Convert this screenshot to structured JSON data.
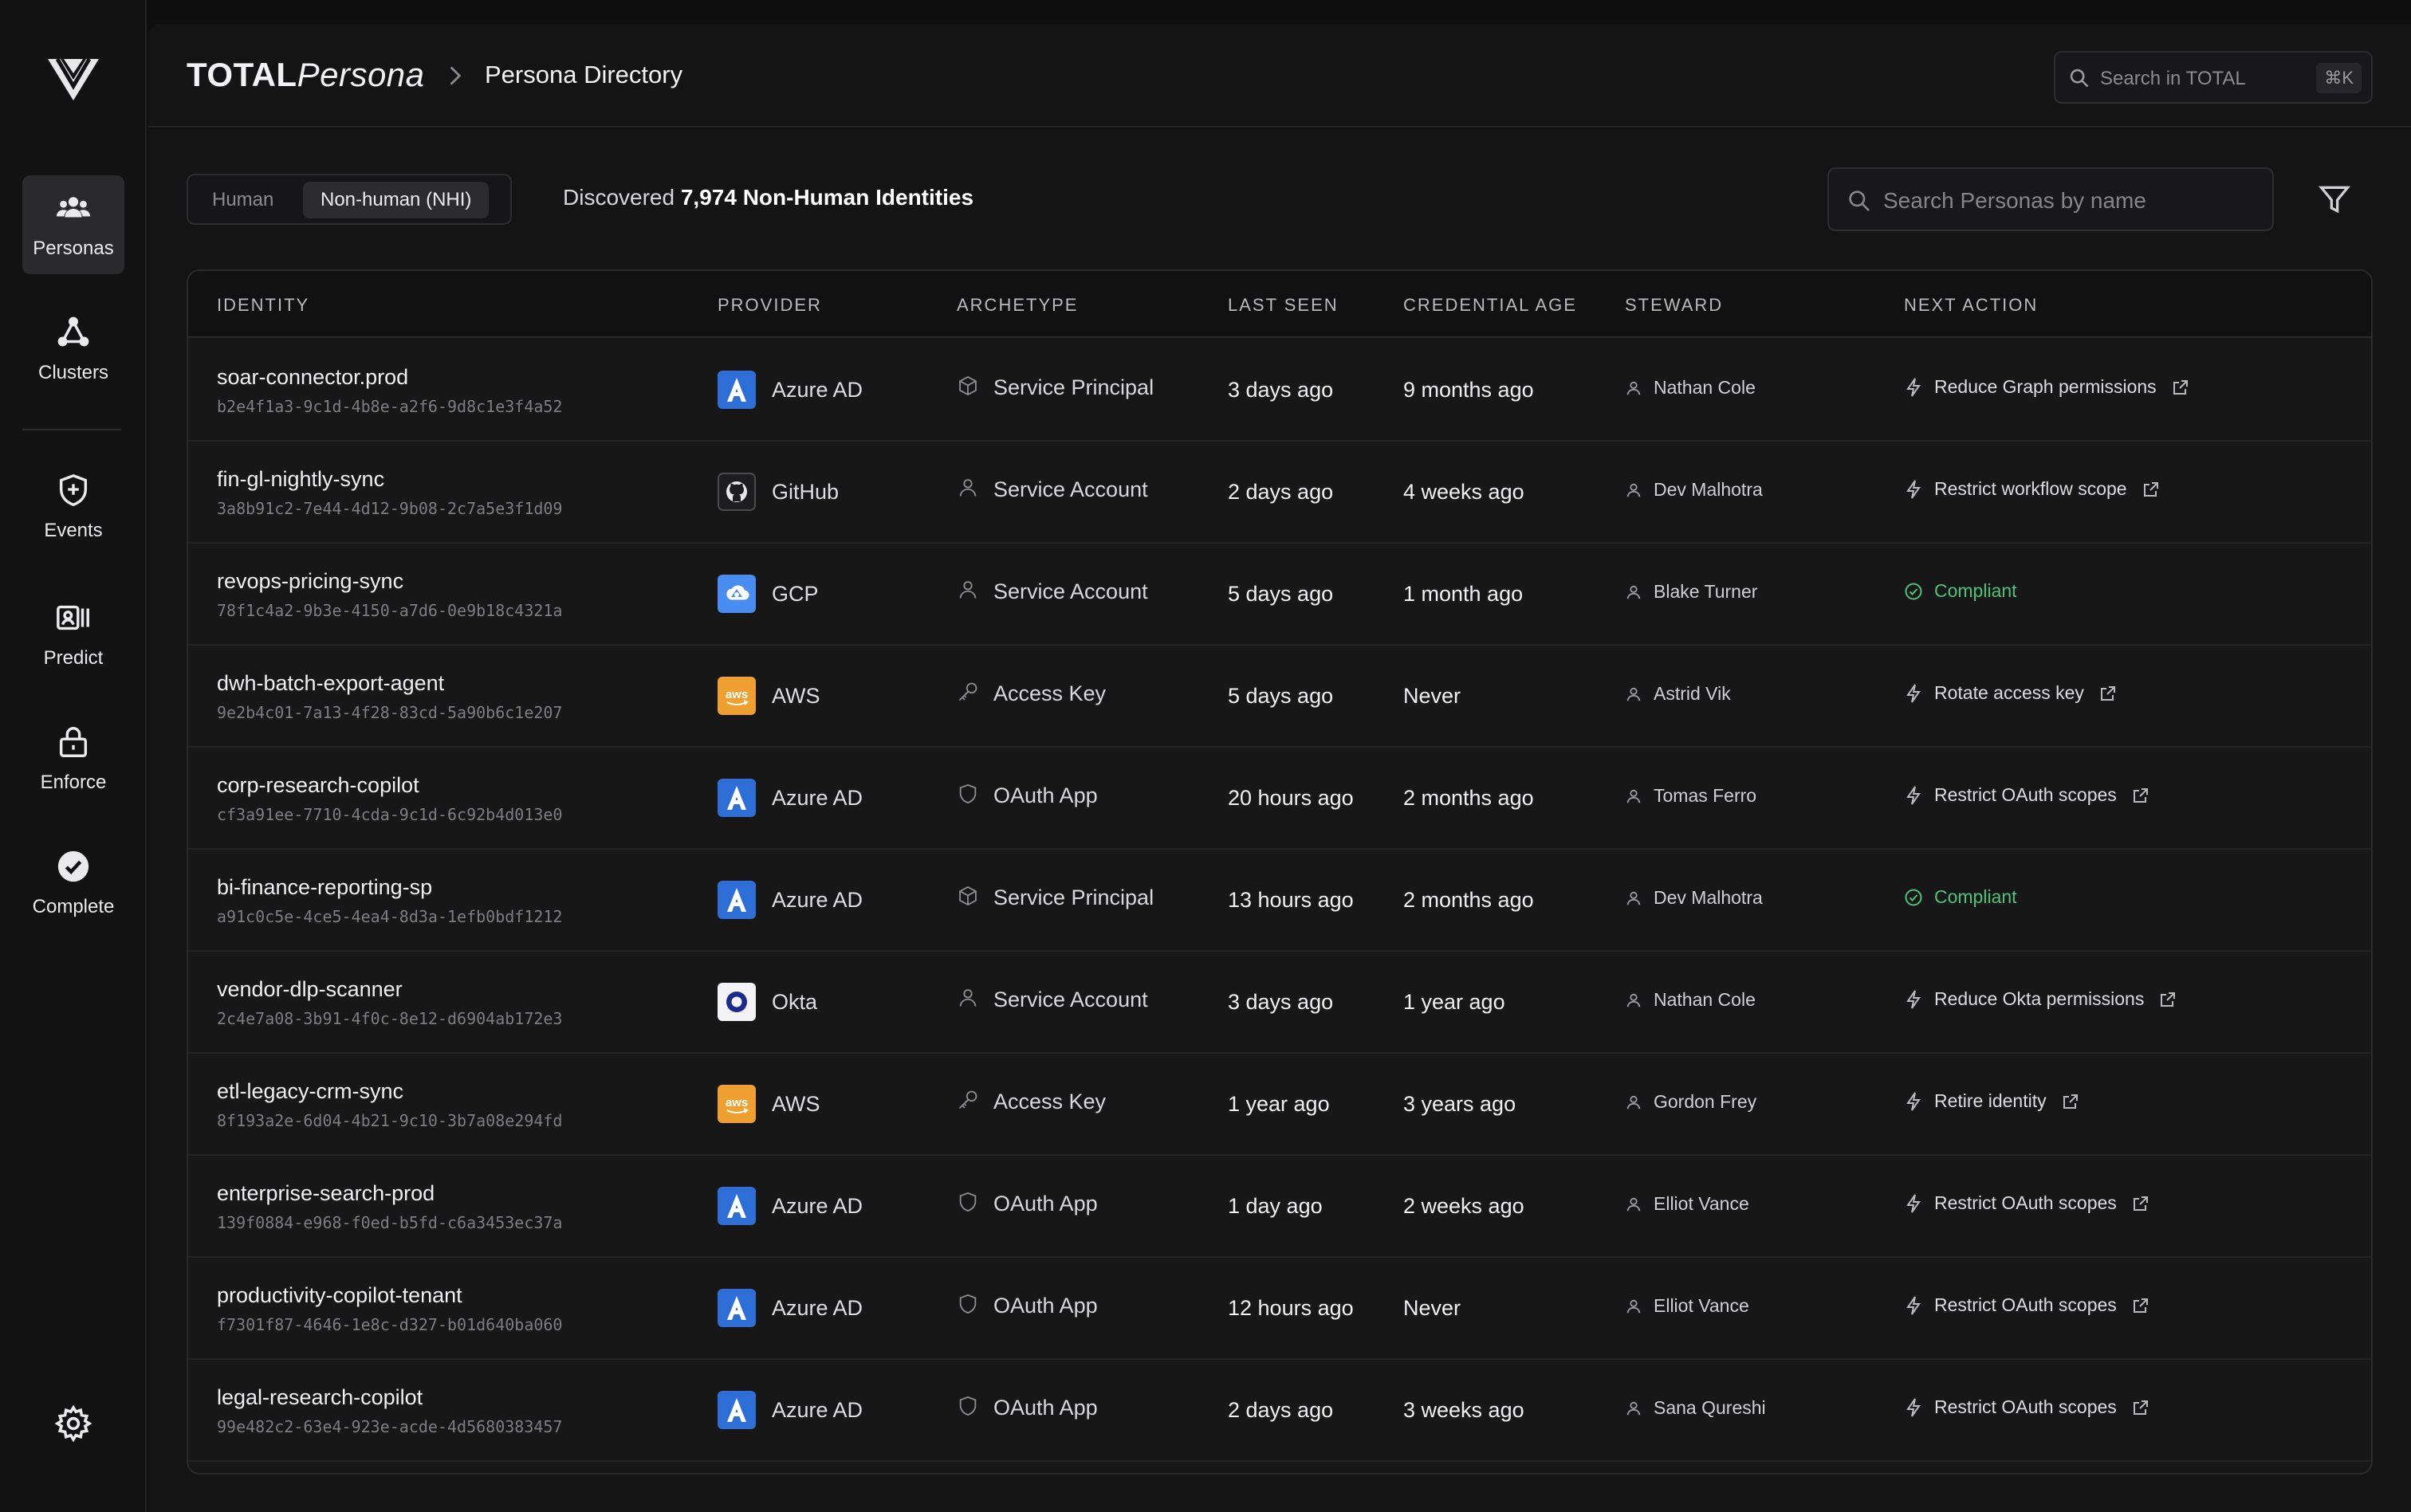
{
  "sidebar": {
    "items": [
      {
        "label": "Personas",
        "icon": "users-icon"
      },
      {
        "label": "Clusters",
        "icon": "cluster-icon"
      },
      {
        "label": "Events",
        "icon": "shield-plus-icon"
      },
      {
        "label": "Predict",
        "icon": "id-card-icon"
      },
      {
        "label": "Enforce",
        "icon": "lock-icon"
      },
      {
        "label": "Complete",
        "icon": "check-circle-icon"
      }
    ],
    "settings_icon": "gear-icon"
  },
  "header": {
    "brand_bold": "TOTAL",
    "brand_italic": "Persona",
    "page": "Persona Directory",
    "search_placeholder": "Search in TOTAL",
    "search_shortcut": "⌘K"
  },
  "toolbar": {
    "tabs": [
      "Human",
      "Non-human (NHI)"
    ],
    "active_tab": "Non-human (NHI)",
    "discovered_prefix": "Discovered",
    "discovered_count": "7,974 Non-Human Identities",
    "search_placeholder": "Search Personas by name"
  },
  "table": {
    "columns": [
      "IDENTITY",
      "PROVIDER",
      "ARCHETYPE",
      "LAST SEEN",
      "CREDENTIAL AGE",
      "STEWARD",
      "NEXT ACTION"
    ],
    "rows": [
      {
        "name": "soar-connector.prod",
        "id": "b2e4f1a3-9c1d-4b8e-a2f6-9d8c1e3f4a52",
        "provider": "Azure AD",
        "archetype": "Service Principal",
        "last_seen": "3 days ago",
        "credential_age": "9 months ago",
        "steward": "Nathan Cole",
        "action": "Reduce Graph permissions",
        "status": "action"
      },
      {
        "name": "fin-gl-nightly-sync",
        "id": "3a8b91c2-7e44-4d12-9b08-2c7a5e3f1d09",
        "provider": "GitHub",
        "archetype": "Service Account",
        "last_seen": "2 days ago",
        "credential_age": "4 weeks ago",
        "steward": "Dev Malhotra",
        "action": "Restrict workflow scope",
        "status": "action"
      },
      {
        "name": "revops-pricing-sync",
        "id": "78f1c4a2-9b3e-4150-a7d6-0e9b18c4321a",
        "provider": "GCP",
        "archetype": "Service Account",
        "last_seen": "5 days ago",
        "credential_age": "1 month ago",
        "steward": "Blake Turner",
        "action": "Compliant",
        "status": "compliant"
      },
      {
        "name": "dwh-batch-export-agent",
        "id": "9e2b4c01-7a13-4f28-83cd-5a90b6c1e207",
        "provider": "AWS",
        "archetype": "Access Key",
        "last_seen": "5 days ago",
        "credential_age": "Never",
        "steward": "Astrid Vik",
        "action": "Rotate access key",
        "status": "action"
      },
      {
        "name": "corp-research-copilot",
        "id": "cf3a91ee-7710-4cda-9c1d-6c92b4d013e0",
        "provider": "Azure AD",
        "archetype": "OAuth App",
        "last_seen": "20 hours ago",
        "credential_age": "2 months ago",
        "steward": "Tomas Ferro",
        "action": "Restrict OAuth scopes",
        "status": "action"
      },
      {
        "name": "bi-finance-reporting-sp",
        "id": "a91c0c5e-4ce5-4ea4-8d3a-1efb0bdf1212",
        "provider": "Azure AD",
        "archetype": "Service Principal",
        "last_seen": "13 hours ago",
        "credential_age": "2 months ago",
        "steward": "Dev Malhotra",
        "action": "Compliant",
        "status": "compliant"
      },
      {
        "name": "vendor-dlp-scanner",
        "id": "2c4e7a08-3b91-4f0c-8e12-d6904ab172e3",
        "provider": "Okta",
        "archetype": "Service Account",
        "last_seen": "3 days ago",
        "credential_age": "1 year ago",
        "steward": "Nathan Cole",
        "action": "Reduce Okta permissions",
        "status": "action"
      },
      {
        "name": "etl-legacy-crm-sync",
        "id": "8f193a2e-6d04-4b21-9c10-3b7a08e294fd",
        "provider": "AWS",
        "archetype": "Access Key",
        "last_seen": "1 year ago",
        "credential_age": "3 years ago",
        "steward": "Gordon Frey",
        "action": "Retire identity",
        "status": "action"
      },
      {
        "name": "enterprise-search-prod",
        "id": "139f0884-e968-f0ed-b5fd-c6a3453ec37a",
        "provider": "Azure AD",
        "archetype": "OAuth App",
        "last_seen": "1 day ago",
        "credential_age": "2 weeks ago",
        "steward": "Elliot Vance",
        "action": "Restrict OAuth scopes",
        "status": "action"
      },
      {
        "name": "productivity-copilot-tenant",
        "id": "f7301f87-4646-1e8c-d327-b01d640ba060",
        "provider": "Azure AD",
        "archetype": "OAuth App",
        "last_seen": "12 hours ago",
        "credential_age": "Never",
        "steward": "Elliot Vance",
        "action": "Restrict OAuth scopes",
        "status": "action"
      },
      {
        "name": "legal-research-copilot",
        "id": "99e482c2-63e4-923e-acde-4d5680383457",
        "provider": "Azure AD",
        "archetype": "OAuth App",
        "last_seen": "2 days ago",
        "credential_age": "3 weeks ago",
        "steward": "Sana Qureshi",
        "action": "Restrict OAuth scopes",
        "status": "action"
      }
    ]
  },
  "colors": {
    "background": "#0f0f10",
    "surface": "#171718",
    "azure": "#2d6fd6",
    "aws": "#f0a030",
    "compliant": "#4cc27a"
  }
}
